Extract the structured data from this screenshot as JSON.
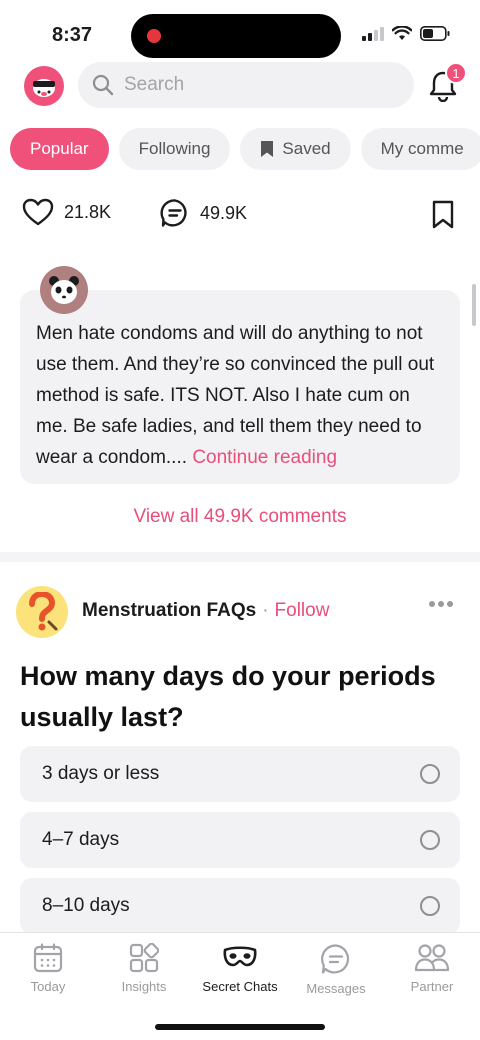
{
  "status_bar": {
    "time": "8:37"
  },
  "header": {
    "search_placeholder": "Search",
    "notification_count": "1"
  },
  "tabs": [
    {
      "label": "Popular",
      "active": true
    },
    {
      "label": "Following",
      "active": false
    },
    {
      "label": "Saved",
      "active": false,
      "icon": "bookmark-icon"
    },
    {
      "label": "My comme",
      "active": false
    }
  ],
  "reactions": {
    "likes": "21.8K",
    "comments": "49.9K"
  },
  "comment": {
    "text": "Men hate condoms and will do anything to not use them. And they’re so convinced the pull out method is safe. ITS NOT. Also I hate cum on me. Be safe ladies, and tell them they need to wear a condom....",
    "continue_label": "Continue reading"
  },
  "view_all_label": "View all 49.9K comments",
  "poll": {
    "community": "Menstruation FAQs",
    "separator": "·",
    "follow_label": "Follow",
    "question": "How many days do your periods usually last?",
    "options": [
      "3 days or less",
      "4–7 days",
      "8–10 days"
    ]
  },
  "bottom_nav": [
    {
      "label": "Today",
      "icon": "calendar-icon",
      "active": false
    },
    {
      "label": "Insights",
      "icon": "grid-icon",
      "active": false
    },
    {
      "label": "Secret Chats",
      "icon": "mask-icon",
      "active": true
    },
    {
      "label": "Messages",
      "icon": "message-icon",
      "active": false
    },
    {
      "label": "Partner",
      "icon": "partner-icon",
      "active": false
    }
  ],
  "colors": {
    "accent": "#f0517a",
    "accent_text": "#e84f7a",
    "card_bg": "#f2f2f4"
  }
}
